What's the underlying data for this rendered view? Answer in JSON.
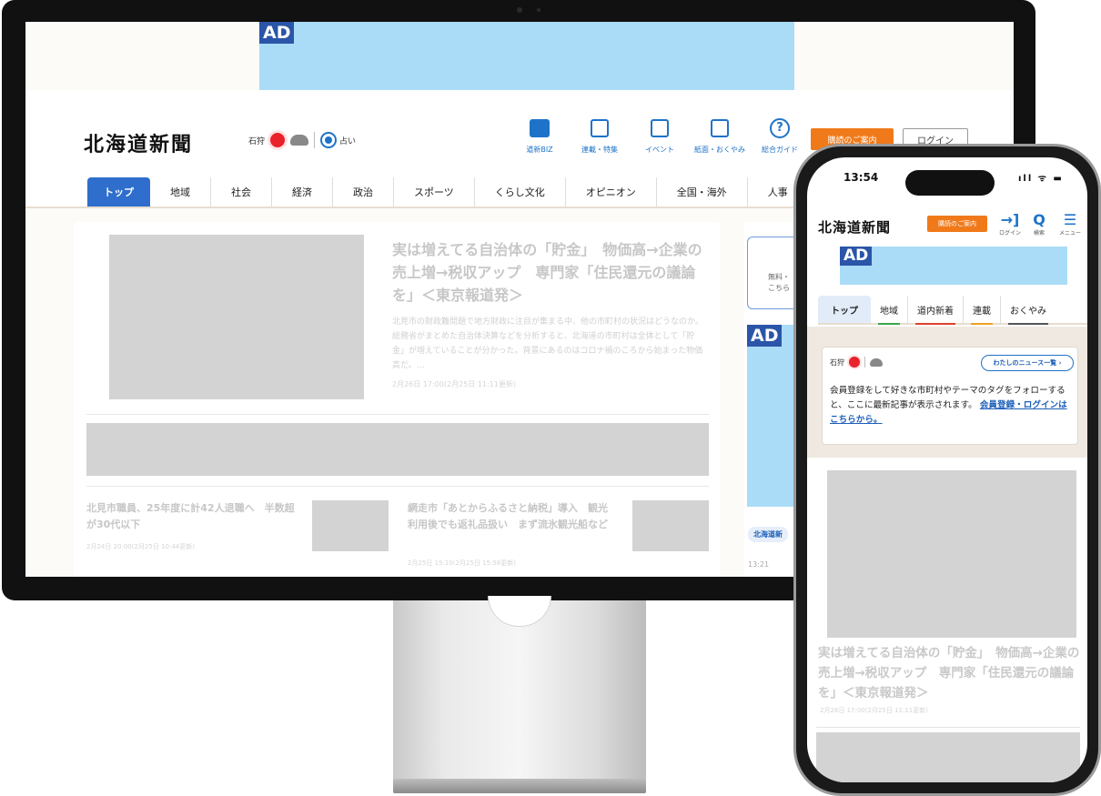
{
  "ad_label": "AD",
  "desktop": {
    "logo": "北海道新聞",
    "weather": {
      "city": "石狩",
      "fortune": "占い"
    },
    "header_icons": [
      {
        "label": "道新BIZ",
        "icon": "bookmark-icon"
      },
      {
        "label": "連載・特集",
        "icon": "flag-icon"
      },
      {
        "label": "イベント",
        "icon": "calendar-icon"
      },
      {
        "label": "紙面・おくやみ",
        "icon": "newspaper-icon"
      },
      {
        "label": "総合ガイド",
        "icon": "help-icon"
      }
    ],
    "subscribe_button": "購読のご案内",
    "login_button": "ログイン",
    "nav": [
      "トップ",
      "地域",
      "社会",
      "経済",
      "政治",
      "スポーツ",
      "くらし文化",
      "オピニオン",
      "全国・海外",
      "人事"
    ],
    "hero": {
      "title": "実は増えてる自治体の「貯金」　物価高→企業の売上増→税収アップ　専門家「住民還元の議論を」＜東京報道発＞",
      "body": "北見市の財政難問題で地方財政に注目が集まる中、他の市町村の状況はどうなのか。総務省がまとめた自治体決算などを分析すると、北海道の市町村は全体として「貯金」が増えていることが分かった。背景にあるのはコロナ禍のころから始まった物価高だ。…",
      "meta": "2月26日 17:00(2月25日 11:11更新)"
    },
    "sub_articles": [
      {
        "title": "北見市職員、25年度に計42人退職へ　半数超が30代以下",
        "meta": "2月24日 20:00(2月25日 10:44更新)"
      },
      {
        "title": "網走市「あとからふるさと納税」導入　観光利用後でも返礼品扱い　まず流氷観光船など",
        "meta": "2月25日 15:10(2月25日 15:58更新)"
      }
    ],
    "sidebar": {
      "box_text_1": "無料・",
      "box_text_2": "こちら",
      "tag": "北海道新",
      "time": "13:21"
    }
  },
  "phone": {
    "time": "13:54",
    "status_icons": "ıll ᯤ ▬",
    "logo": "北海道新聞",
    "subscribe_button": "購読のご案内",
    "header_icons": [
      {
        "label": "ログイン",
        "glyph": "→]",
        "icon": "login-icon"
      },
      {
        "label": "検索",
        "glyph": "Q",
        "icon": "search-icon"
      },
      {
        "label": "メニュー",
        "glyph": "☰",
        "icon": "menu-icon"
      }
    ],
    "nav": [
      {
        "label": "トップ",
        "color": ""
      },
      {
        "label": "地域",
        "color": "#3aa54a"
      },
      {
        "label": "道内新着",
        "color": "#e0412f"
      },
      {
        "label": "連載",
        "color": "#f0a020"
      },
      {
        "label": "おくやみ",
        "color": "#555555"
      }
    ],
    "card": {
      "city": "石狩",
      "my_news_button": "わたしのニュース一覧 ›",
      "text": "会員登録をして好きな市町村やテーマのタグをフォローすると、ここに最新記事が表示されます。",
      "link": "会員登録・ログインはこちらから。"
    },
    "article": {
      "title": "実は増えてる自治体の「貯金」　物価高→企業の売上増→税収アップ　専門家「住民還元の議論を」＜東京報道発＞",
      "meta": "2月26日 17:00(2月25日 11:11更新)"
    }
  }
}
